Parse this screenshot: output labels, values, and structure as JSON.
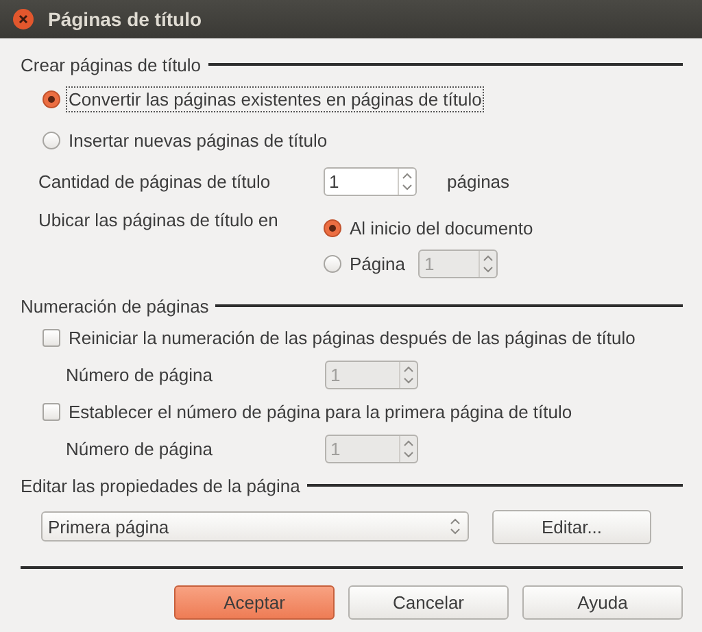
{
  "window": {
    "title": "Páginas de título"
  },
  "create": {
    "heading": "Crear páginas de título",
    "modes": [
      {
        "label": "Convertir las páginas existentes en páginas de título",
        "selected": true
      },
      {
        "label": "Insertar nuevas páginas de título",
        "selected": false
      }
    ],
    "count": {
      "label": "Cantidad de páginas de título",
      "value": "1",
      "unit": "páginas",
      "disabled": false
    },
    "place": {
      "label": "Ubicar las páginas de título en",
      "options": [
        {
          "kind": "plain",
          "label": "Al inicio del documento",
          "selected": true
        },
        {
          "kind": "spin",
          "label": "Página",
          "selected": false,
          "value": "1",
          "disabled": true
        }
      ]
    }
  },
  "numbering": {
    "heading": "Numeración de páginas",
    "options": [
      {
        "label": "Reiniciar la numeración de las páginas después de las páginas de título",
        "checked": false,
        "number": {
          "label": "Número de página",
          "value": "1",
          "disabled": true
        }
      },
      {
        "label": "Establecer el número de página para la primera página de título",
        "checked": false,
        "number": {
          "label": "Número de página",
          "value": "1",
          "disabled": true
        }
      }
    ]
  },
  "properties": {
    "heading": "Editar las propiedades de la página",
    "dropdown": {
      "value": "Primera página"
    },
    "edit_button": "Editar..."
  },
  "buttons": [
    {
      "label": "Aceptar",
      "default": true
    },
    {
      "label": "Cancelar",
      "default": false
    },
    {
      "label": "Ayuda",
      "default": false
    }
  ]
}
